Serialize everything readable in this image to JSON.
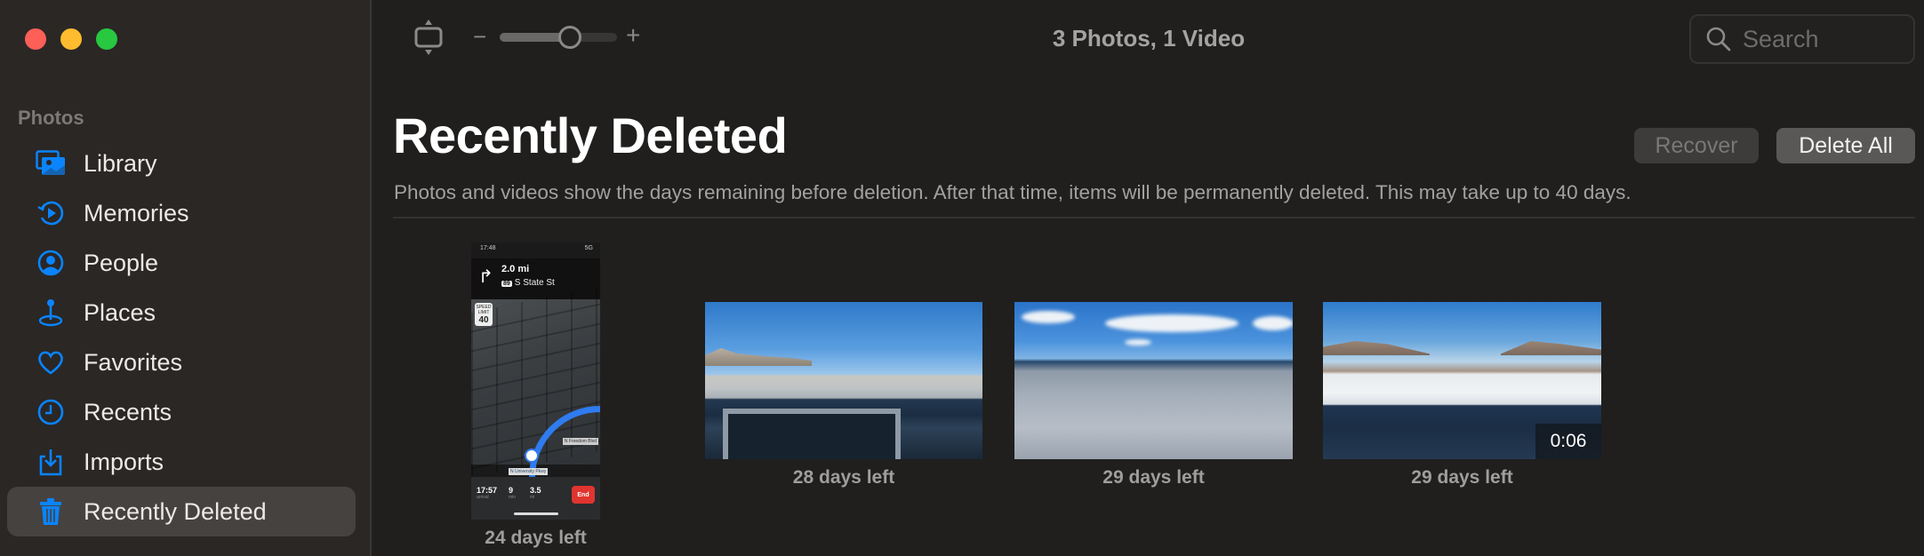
{
  "window": {
    "traffic_lights": [
      "close",
      "minimize",
      "maximize"
    ]
  },
  "sidebar": {
    "section_label": "Photos",
    "items": [
      {
        "label": "Library",
        "icon": "photo-stack-icon",
        "active": false
      },
      {
        "label": "Memories",
        "icon": "memories-play-icon",
        "active": false
      },
      {
        "label": "People",
        "icon": "person-circle-icon",
        "active": false
      },
      {
        "label": "Places",
        "icon": "map-pin-icon",
        "active": false
      },
      {
        "label": "Favorites",
        "icon": "heart-icon",
        "active": false
      },
      {
        "label": "Recents",
        "icon": "clock-icon",
        "active": false
      },
      {
        "label": "Imports",
        "icon": "import-tray-icon",
        "active": false
      },
      {
        "label": "Recently Deleted",
        "icon": "trash-icon",
        "active": true
      }
    ],
    "accent_color": "#0a84ff"
  },
  "toolbar": {
    "zoom_minus": "−",
    "zoom_plus": "+",
    "zoom_level_fraction": 0.6,
    "item_count": "3 Photos, 1 Video",
    "search_placeholder": "Search",
    "search_value": ""
  },
  "header": {
    "title": "Recently Deleted",
    "recover_label": "Recover",
    "delete_all_label": "Delete All",
    "description": "Photos and videos show the days remaining before deletion. After that time, items will be permanently deleted. This may take up to 40 days."
  },
  "items": [
    {
      "type": "photo",
      "kind": "screenshot",
      "caption": "24 days left",
      "screenshot": {
        "status_time": "17:48",
        "status_right": "5G",
        "distance": "2.0 mi",
        "route_badge": "89",
        "street": "S State St",
        "speed_limit_label": "SPEED LIMIT",
        "speed_limit": "40",
        "street_tag": "N University Pkwy",
        "side_tag": "N Freedom Blvd",
        "arrival": "17:57",
        "arrival_label": "arrival",
        "minutes": "9",
        "minutes_label": "min",
        "miles": "3.5",
        "miles_label": "mi",
        "end_button": "End"
      }
    },
    {
      "type": "photo",
      "kind": "landscape",
      "caption": "28 days left"
    },
    {
      "type": "photo",
      "kind": "landscape",
      "caption": "29 days left"
    },
    {
      "type": "video",
      "kind": "landscape",
      "caption": "29 days left",
      "duration": "0:06"
    }
  ]
}
